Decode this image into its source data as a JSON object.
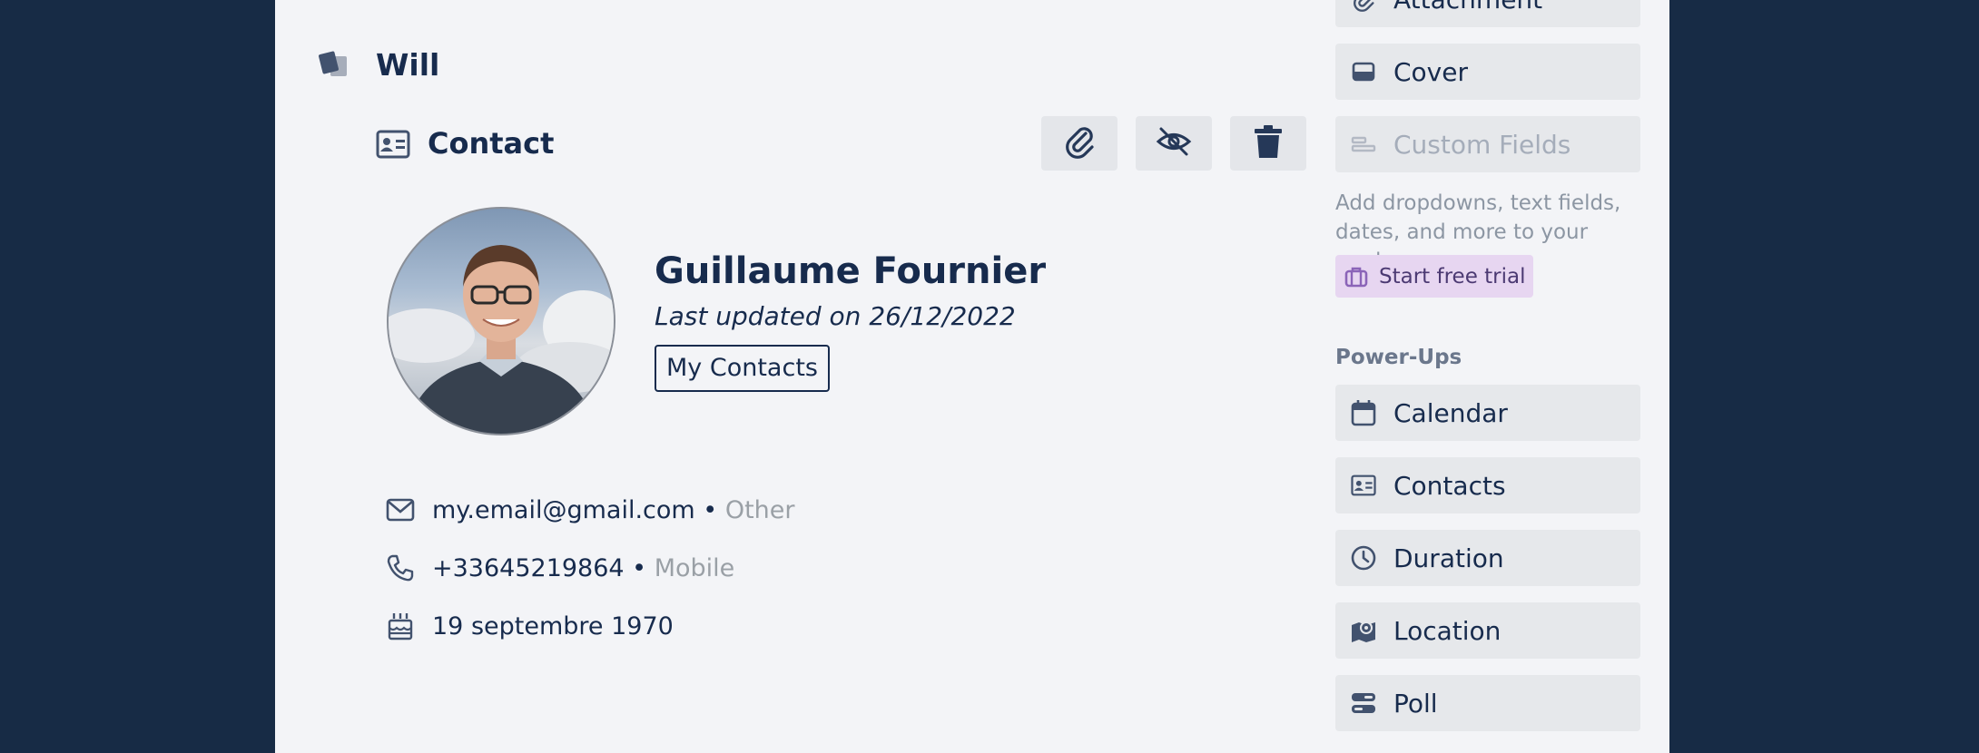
{
  "card": {
    "title": "Will"
  },
  "section": {
    "title": "Contact"
  },
  "toolbar": {
    "attach_icon": "paperclip-icon",
    "hide_icon": "eye-slash-icon",
    "delete_icon": "trash-icon"
  },
  "contact": {
    "name": "Guillaume Fournier",
    "updated": "Last updated on 26/12/2022",
    "tag": "My Contacts",
    "email": "my.email@gmail.com",
    "email_sep": " • ",
    "email_type": "Other",
    "phone": "+33645219864",
    "phone_sep": " • ",
    "phone_type": "Mobile",
    "birthday": "19 septembre 1970"
  },
  "sidebar": {
    "attachment": "Attachment",
    "cover": "Cover",
    "custom_fields": "Custom Fields",
    "custom_fields_desc": "Add dropdowns, text fields, dates, and more to your cards.",
    "trial": "Start free trial",
    "powerups_label": "Power-Ups",
    "powerups": [
      {
        "label": "Calendar",
        "icon": "calendar-icon"
      },
      {
        "label": "Contacts",
        "icon": "contact-card-icon"
      },
      {
        "label": "Duration",
        "icon": "clock-icon"
      },
      {
        "label": "Location",
        "icon": "map-marker-icon"
      },
      {
        "label": "Poll",
        "icon": "poll-icon"
      }
    ]
  },
  "colors": {
    "background": "#172b45",
    "panel": "#f3f4f7",
    "text": "#172b4d",
    "trial_bg": "#e7d6f1"
  }
}
